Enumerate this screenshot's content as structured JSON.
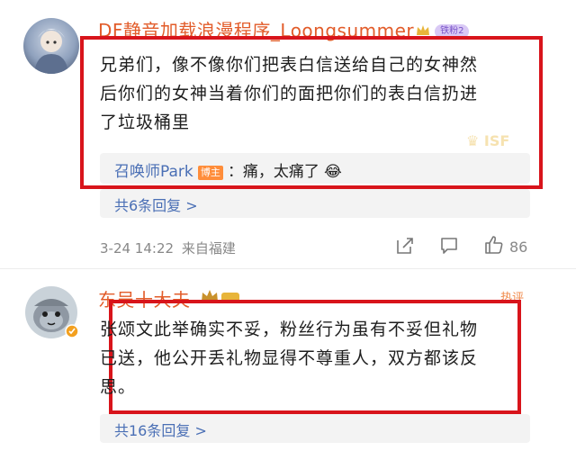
{
  "comments": [
    {
      "username": "DF静音加载浪漫程序_Loongsummer",
      "fan_badge": "铁粉2",
      "text_lines": [
        "兄弟们，像不像你们把表白信送给自己的女神然",
        "后你们的女神当着你们的面把你们的表白信扔进",
        "了垃圾桶里"
      ],
      "reply": {
        "author": "召唤师Park",
        "author_tag": "博主",
        "text": "：痛，太痛了",
        "emoji": "😂"
      },
      "more_replies": "共6条回复 >",
      "timestamp": "3-24 14:22",
      "location": "来自福建",
      "like_count": "86"
    },
    {
      "username": "东吴十大夫",
      "corner_label": "热评",
      "text_lines": [
        "张颂文此举确实不妥，粉丝行为虽有不妥但礼物",
        "已送，他公开丢礼物显得不尊重人，双方都该反",
        "思。"
      ],
      "more_replies": "共16条回复 >"
    }
  ],
  "colors": {
    "highlight_frame": "#d8141b",
    "username": "#e25c2a",
    "link": "#4a6fb5"
  }
}
